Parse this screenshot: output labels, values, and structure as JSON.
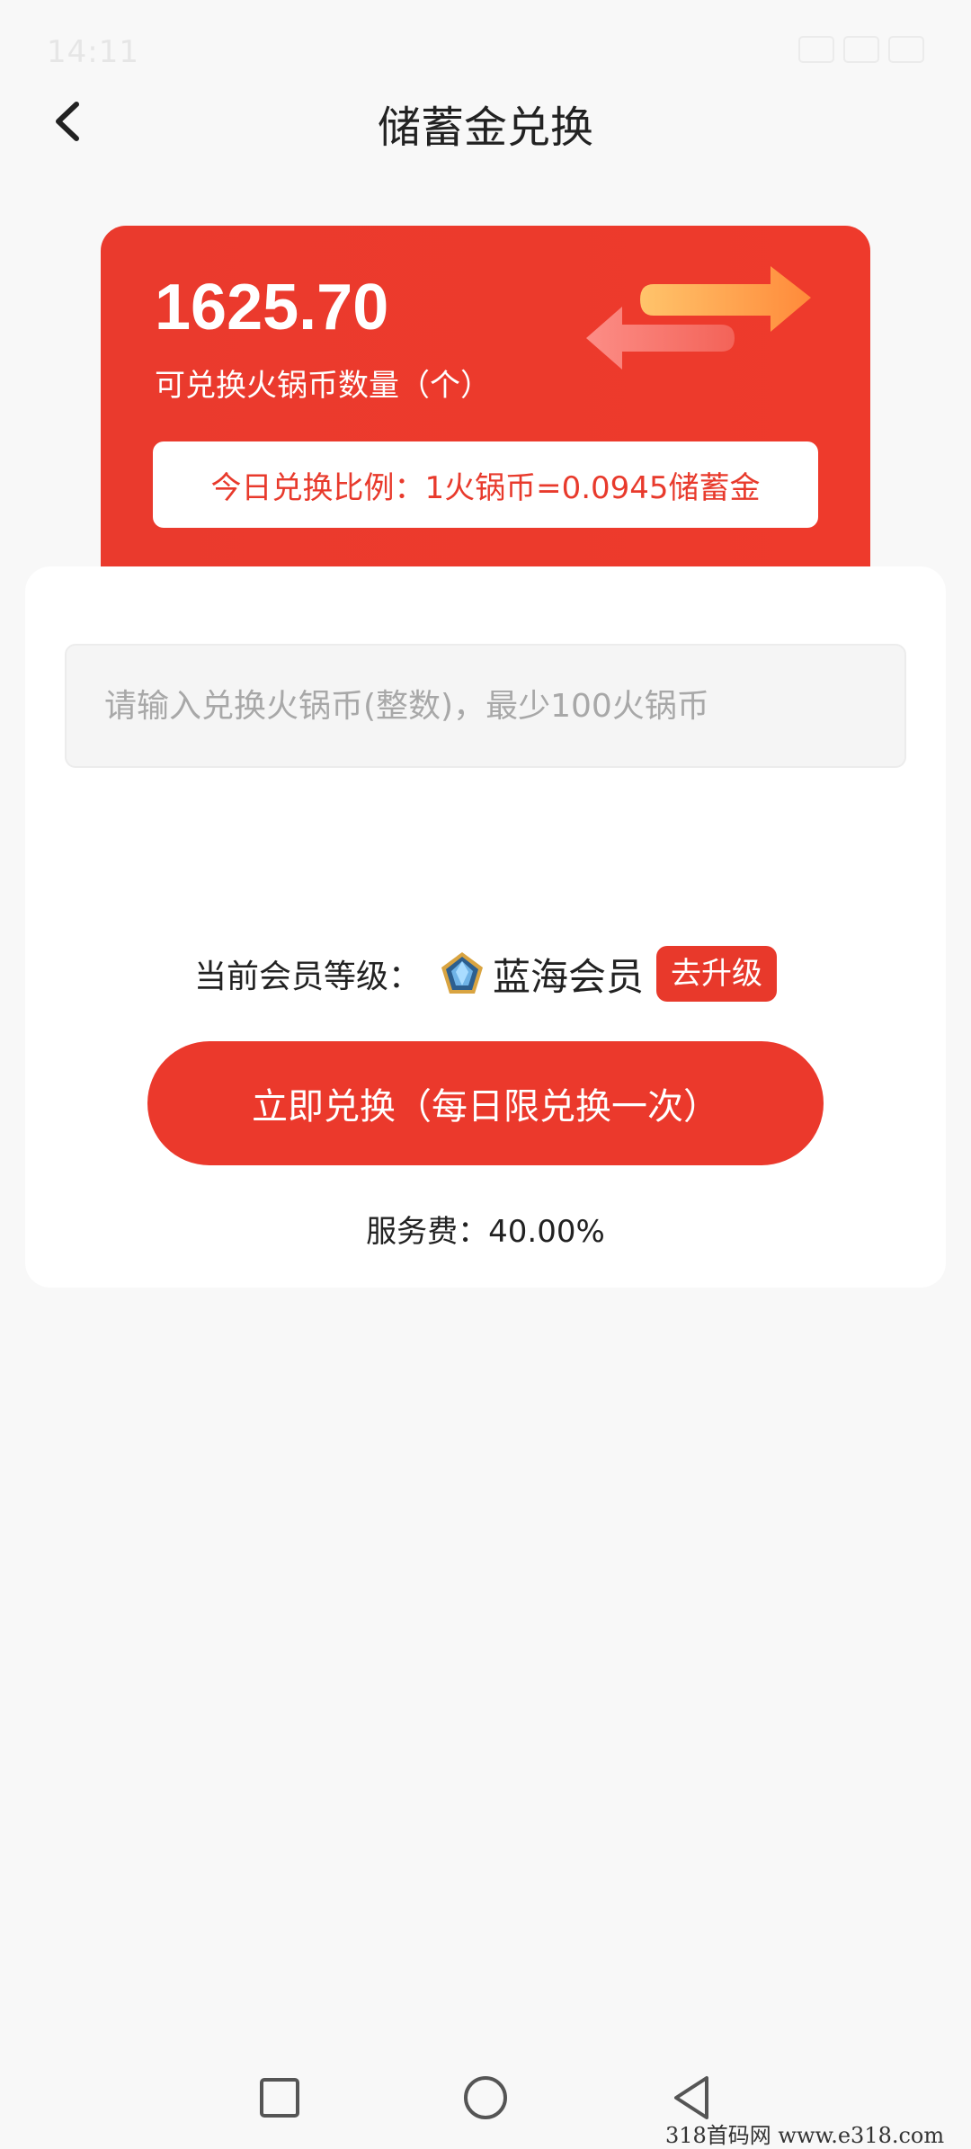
{
  "status_bar": {
    "time": "14:11"
  },
  "header": {
    "title": "储蓄金兑换",
    "back_icon": "chevron-left-icon"
  },
  "summary": {
    "balance": "1625.70",
    "balance_label": "可兑换火锅币数量（个）",
    "ratio_text": "今日兑换比例：1火锅币=0.0945储蓄金"
  },
  "form": {
    "input_value": "",
    "input_placeholder": "请输入兑换火锅币(整数)，最少100火锅币"
  },
  "membership": {
    "label": "当前会员等级：",
    "level": "蓝海会员",
    "badge_icon": "blue-gem-badge-icon",
    "upgrade_label": "去升级"
  },
  "actions": {
    "exchange_label": "立即兑换（每日限兑换一次）"
  },
  "fee": {
    "text": "服务费：40.00%"
  },
  "colors": {
    "primary_red": "#eb392c",
    "background": "#f8f8f8",
    "card": "#ffffff"
  },
  "watermark": {
    "text": "318首码网  www.e318.com"
  }
}
